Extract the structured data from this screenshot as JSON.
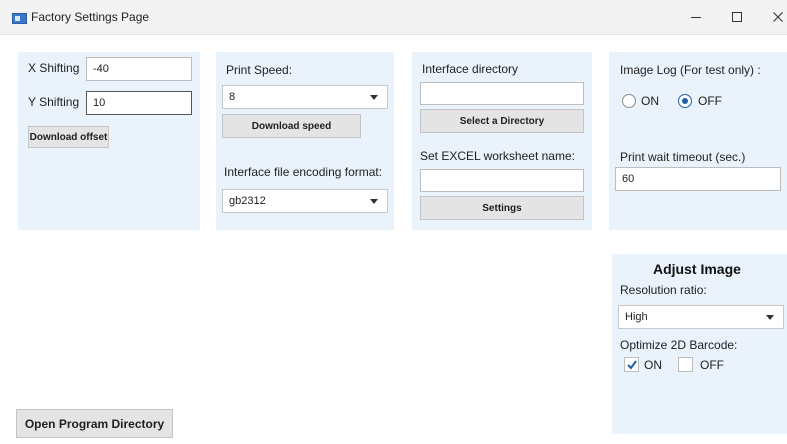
{
  "window": {
    "title": "Factory Settings Page",
    "icon": "app-window-icon",
    "controls": {
      "minimize": "minimize-icon",
      "maximize": "maximize-icon",
      "close": "close-icon"
    }
  },
  "offset_panel": {
    "x_label": "X Shifting",
    "x_value": "-40",
    "y_label": "Y Shifting",
    "y_value": "10",
    "download_button": "Download offset"
  },
  "speed_panel": {
    "speed_label": "Print Speed:",
    "speed_value": "8",
    "download_button": "Download speed",
    "encoding_label": "Interface file encoding format:",
    "encoding_value": "gb2312"
  },
  "directory_panel": {
    "dir_label": "Interface directory",
    "dir_value": "",
    "select_button": "Select a Directory",
    "excel_label": "Set EXCEL worksheet name:",
    "excel_value": "",
    "settings_button": "Settings"
  },
  "log_panel": {
    "log_label": "Image Log (For test only) :",
    "on_label": "ON",
    "off_label": "OFF",
    "selected": "OFF",
    "timeout_label": "Print wait timeout (sec.)",
    "timeout_value": "60"
  },
  "adjust_panel": {
    "heading": "Adjust Image",
    "resolution_label": "Resolution ratio:",
    "resolution_value": "High",
    "barcode_label": "Optimize 2D Barcode:",
    "on_label": "ON",
    "on_checked": true,
    "off_label": "OFF",
    "off_checked": false
  },
  "footer": {
    "open_dir_button": "Open Program Directory"
  },
  "colors": {
    "panel_bg": "#eaf2fb",
    "button_bg": "#e4e4e4",
    "accent": "#1f5fa8"
  }
}
